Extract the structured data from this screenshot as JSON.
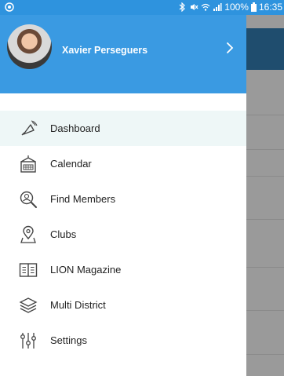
{
  "status_bar": {
    "battery": "100%",
    "time": "16:35"
  },
  "drawer": {
    "user_name": "Xavier Perseguers",
    "items": [
      {
        "label": "Dashboard",
        "icon": "megaphone-icon",
        "active": true
      },
      {
        "label": "Calendar",
        "icon": "calendar-icon"
      },
      {
        "label": "Find Members",
        "icon": "magnifier-person-icon"
      },
      {
        "label": "Clubs",
        "icon": "map-pin-icon"
      },
      {
        "label": "LION Magazine",
        "icon": "book-icon"
      },
      {
        "label": "Multi District",
        "icon": "layers-icon"
      },
      {
        "label": "Settings",
        "icon": "sliders-icon"
      }
    ]
  },
  "colors": {
    "status_bar": "#2e93de",
    "drawer_header": "#3a9ae2",
    "active_item_bg": "#eef7f7",
    "overlay": "#9a9a9a"
  }
}
